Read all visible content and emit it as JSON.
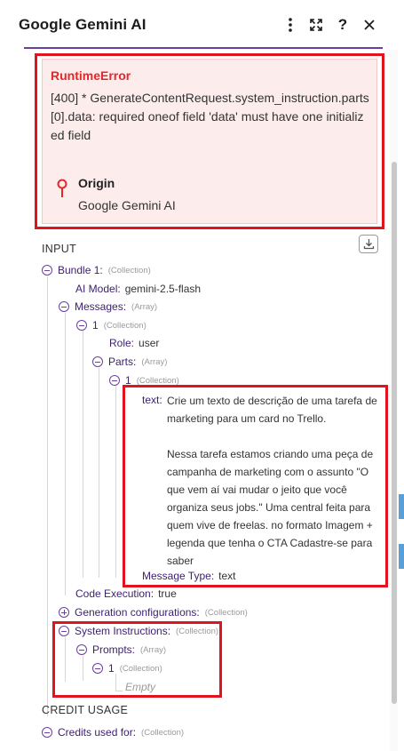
{
  "header": {
    "title": "Google Gemini AI"
  },
  "error": {
    "title": "RuntimeError",
    "message": "[400] * GenerateContentRequest.system_instruction.parts[0].data: required oneof field 'data' must have one initialized field",
    "origin_label": "Origin",
    "origin_value": "Google Gemini AI"
  },
  "input": {
    "section_label": "INPUT",
    "bundle": {
      "key": "Bundle 1:",
      "type": "(Collection)"
    },
    "ai_model": {
      "key": "AI Model:",
      "value": "gemini-2.5-flash"
    },
    "messages": {
      "key": "Messages:",
      "type": "(Array)"
    },
    "message_item": {
      "key": "1",
      "type": "(Collection)"
    },
    "role": {
      "key": "Role:",
      "value": "user"
    },
    "parts": {
      "key": "Parts:",
      "type": "(Array)"
    },
    "part_item": {
      "key": "1",
      "type": "(Collection)"
    },
    "text": {
      "key": "text:",
      "value": "Crie um texto de descrição de uma tarefa de marketing para um card no Trello.\n\nNessa tarefa estamos criando uma peça de campanha de marketing com o assunto \"O que vem aí vai mudar o jeito que você organiza seus jobs.\" Uma central feita para quem vive de freelas. no formato Imagem + legenda que tenha o CTA Cadastre-se para saber"
    },
    "message_type": {
      "key": "Message Type:",
      "value": "text"
    },
    "code_execution": {
      "key": "Code Execution:",
      "value": "true"
    },
    "generation_configurations": {
      "key": "Generation configurations:",
      "type": "(Collection)"
    },
    "system_instructions": {
      "key": "System Instructions:",
      "type": "(Collection)"
    },
    "prompts": {
      "key": "Prompts:",
      "type": "(Array)"
    },
    "prompt_item": {
      "key": "1",
      "type": "(Collection)"
    },
    "empty_label": "Empty"
  },
  "credit_usage": {
    "section_label": "CREDIT USAGE",
    "credits": {
      "key": "Credits used for:",
      "type": "(Collection)"
    }
  }
}
